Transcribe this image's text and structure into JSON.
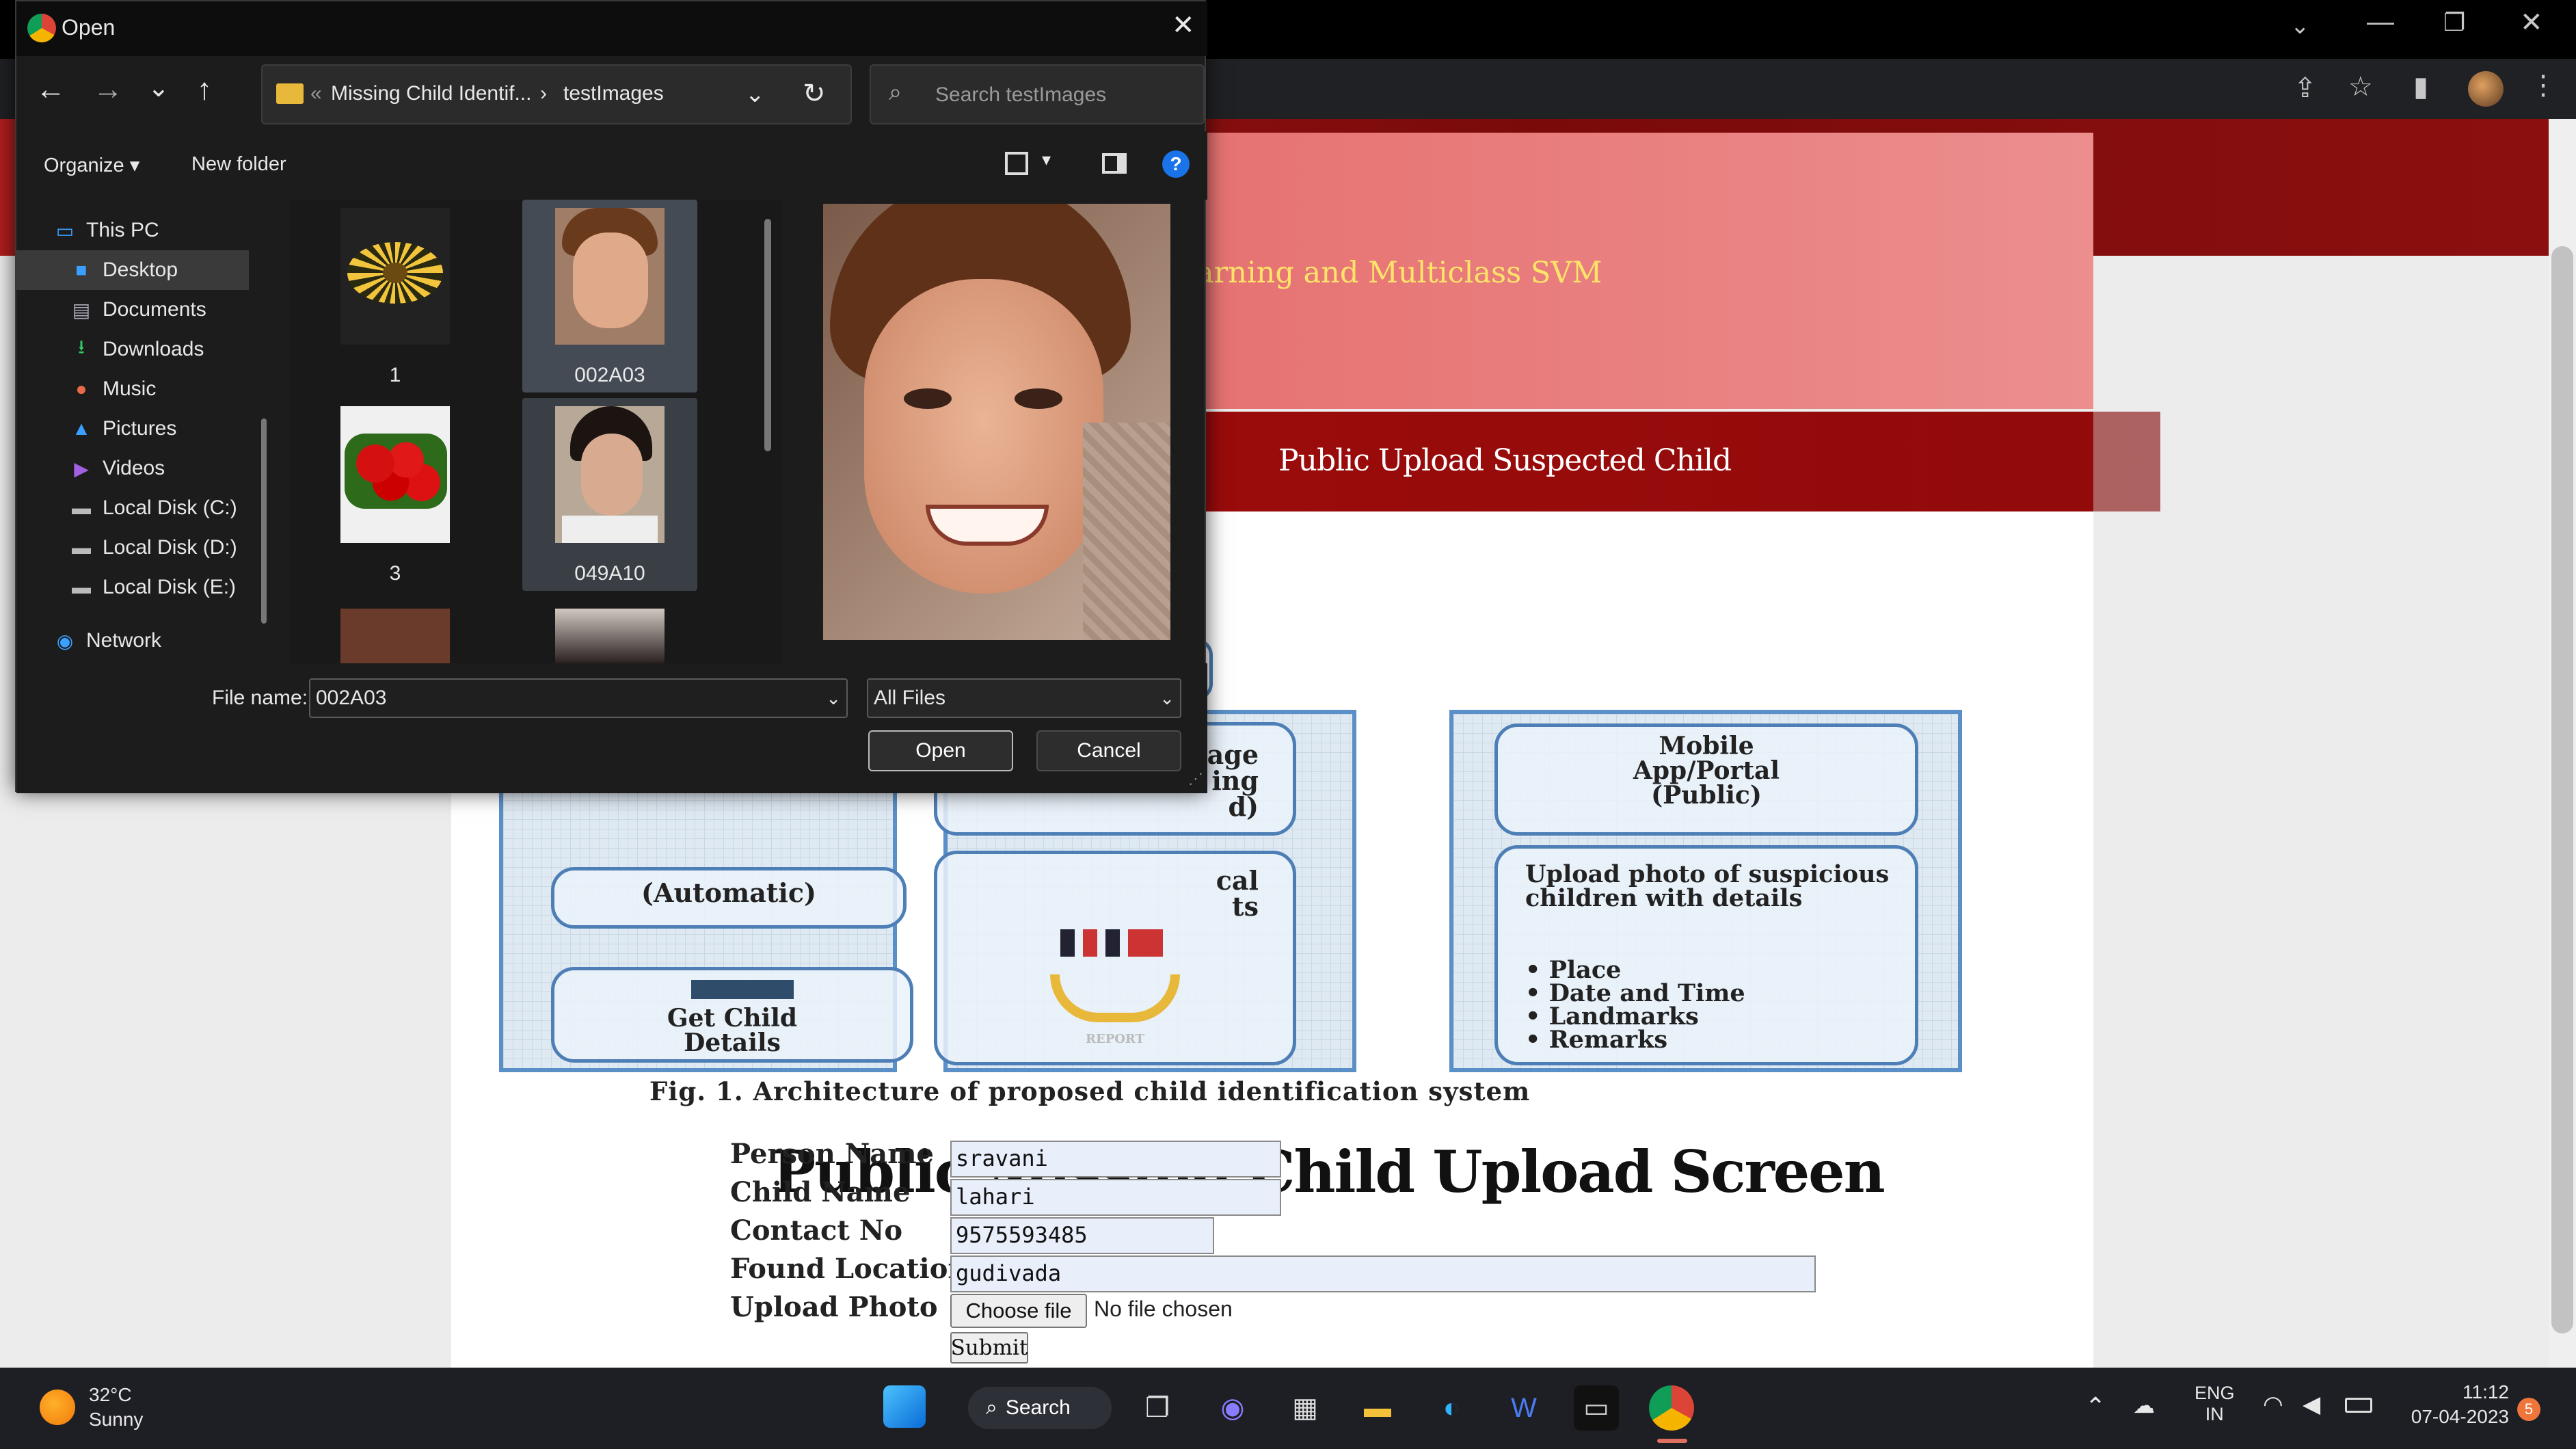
{
  "browser": {
    "toolbar_icons": [
      "share-icon",
      "star-icon",
      "sidebar-icon",
      "avatar",
      "kebab-menu-icon"
    ]
  },
  "page": {
    "header_title": "arning and Multiclass SVM",
    "nav_tab": "Public Upload Suspected Child",
    "figure": {
      "box_right_title": "Mobile\nApp/Portal\n(Public)",
      "box_right_body": "Upload photo of suspicious children with details",
      "box_right_bullets": [
        "Place",
        "Date and Time",
        "Landmarks",
        "Remarks"
      ],
      "box_left_top": "(Automatic)",
      "box_left_bottom": "Get Child\nDetails",
      "box_mid_top": "ssage\ning\nd)",
      "box_mid_mid": "cal\nts",
      "box_mid_report": "REPORT",
      "caption": "Fig. 1.    Architecture of proposed child identification system"
    },
    "heading": "Public Missing Child Upload Screen",
    "form": {
      "person_name_label": "Person Name",
      "person_name_value": "sravani",
      "child_name_label": "Child Name",
      "child_name_value": "lahari",
      "contact_label": "Contact No",
      "contact_value": "9575593485",
      "location_label": "Found Location",
      "location_value": "gudivada",
      "upload_label": "Upload Photo",
      "choose_file": "Choose file",
      "no_file": "No file chosen",
      "submit": "Submit"
    }
  },
  "dialog": {
    "title": "Open",
    "breadcrumb_overflow": "«",
    "breadcrumb": [
      "Missing Child Identif...",
      "testImages"
    ],
    "search_placeholder": "Search testImages",
    "organize": "Organize",
    "new_folder": "New folder",
    "nav_items": [
      {
        "label": "This PC",
        "icon": "pc-icon"
      },
      {
        "label": "Desktop",
        "icon": "desktop-icon"
      },
      {
        "label": "Documents",
        "icon": "documents-icon"
      },
      {
        "label": "Downloads",
        "icon": "downloads-icon"
      },
      {
        "label": "Music",
        "icon": "music-icon"
      },
      {
        "label": "Pictures",
        "icon": "pictures-icon"
      },
      {
        "label": "Videos",
        "icon": "videos-icon"
      },
      {
        "label": "Local Disk (C:)",
        "icon": "disk-icon"
      },
      {
        "label": "Local Disk (D:)",
        "icon": "disk-icon"
      },
      {
        "label": "Local Disk (E:)",
        "icon": "disk-icon"
      },
      {
        "label": "Network",
        "icon": "network-icon"
      }
    ],
    "files": [
      "1",
      "002A03",
      "3",
      "049A10"
    ],
    "filename_label": "File name:",
    "filename_value": "002A03",
    "filter_value": "All Files",
    "open_button": "Open",
    "cancel_button": "Cancel"
  },
  "taskbar": {
    "weather_temp": "32°C",
    "weather_desc": "Sunny",
    "search_label": "Search",
    "lang_top": "ENG",
    "lang_bottom": "IN",
    "time": "11:12",
    "date": "07-04-2023",
    "notification_count": "5"
  }
}
